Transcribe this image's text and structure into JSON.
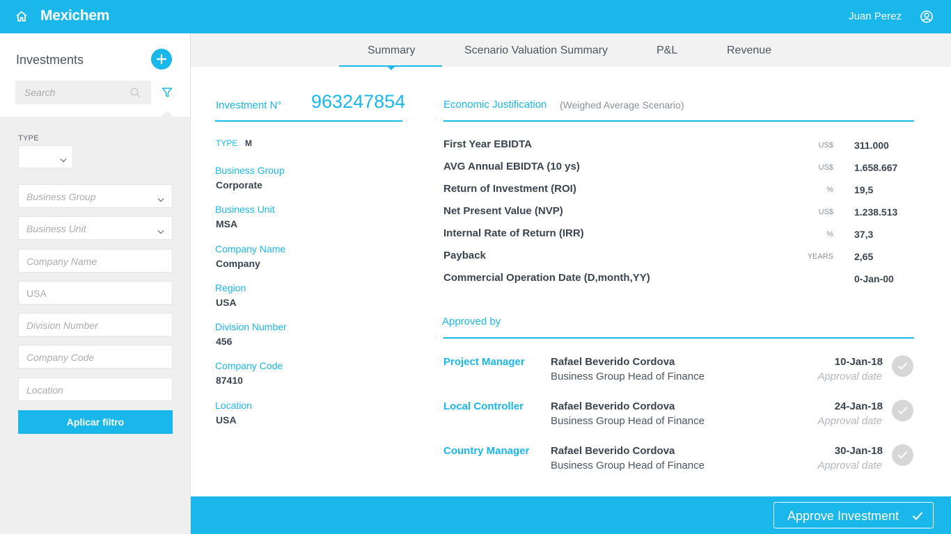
{
  "header": {
    "app_name": "Mexichem",
    "user_name": "Juan Perez"
  },
  "sidebar": {
    "title": "Investments",
    "search_placeholder": "Search",
    "type_label": "TYPE",
    "fields": [
      {
        "placeholder": "Business Group"
      },
      {
        "placeholder": "Business Unit"
      },
      {
        "placeholder": "Company Name"
      },
      {
        "value": "USA"
      },
      {
        "placeholder": "Division Number"
      },
      {
        "placeholder": "Company Code"
      },
      {
        "placeholder": "Location"
      }
    ],
    "apply_label": "Aplicar filtro"
  },
  "tabs": [
    {
      "label": "Summary",
      "active": true
    },
    {
      "label": "Scenario Valuation Summary"
    },
    {
      "label": "P&L"
    },
    {
      "label": "Revenue"
    }
  ],
  "investment": {
    "label": "Investment N°",
    "number": "963247854",
    "type_label": "TYPE",
    "type_value": "M",
    "details": [
      {
        "label": "Business Group",
        "value": "Corporate"
      },
      {
        "label": "Business Unit",
        "value": "MSA"
      },
      {
        "label": "Company Name",
        "value": "Company"
      },
      {
        "label": "Region",
        "value": "USA"
      },
      {
        "label": "Division Number",
        "value": "456"
      },
      {
        "label": "Company Code",
        "value": "87410"
      },
      {
        "label": "Location",
        "value": "USA"
      }
    ]
  },
  "economic": {
    "title": "Economic Justification",
    "subtitle": "(Weighed Average Scenario)",
    "metrics": [
      {
        "name": "First Year EBIDTA",
        "unit": "US$",
        "value": "311.000"
      },
      {
        "name": "AVG Annual EBIDTA (10 ys)",
        "unit": "US$",
        "value": "1.658.667"
      },
      {
        "name": "Return of Investment (ROI)",
        "unit": "%",
        "value": "19,5"
      },
      {
        "name": "Net Present Value (NVP)",
        "unit": "US$",
        "value": "1.238.513"
      },
      {
        "name": "Internal Rate of Return (IRR)",
        "unit": "%",
        "value": "37,3"
      },
      {
        "name": "Payback",
        "unit": "YEARS",
        "value": "2,65"
      },
      {
        "name": "Commercial Operation Date (D,month,YY)",
        "unit": "",
        "value": "0-Jan-00"
      }
    ]
  },
  "approved": {
    "title": "Approved by",
    "approvals": [
      {
        "role": "Project Manager",
        "name": "Rafael Beverido Cordova",
        "position": "Business Group Head of Finance",
        "date": "10-Jan-18",
        "date_label": "Approval date"
      },
      {
        "role": "Local Controller",
        "name": "Rafael Beverido Cordova",
        "position": "Business Group Head of Finance",
        "date": "24-Jan-18",
        "date_label": "Approval date"
      },
      {
        "role": "Country Manager",
        "name": "Rafael Beverido Cordova",
        "position": "Business Group Head of Finance",
        "date": "30-Jan-18",
        "date_label": "Approval date"
      }
    ]
  },
  "footer": {
    "approve_label": "Approve Investment"
  },
  "colors": {
    "accent": "#1ab7ea",
    "sidebar_bg": "#efefef",
    "text": "#3a4450"
  }
}
